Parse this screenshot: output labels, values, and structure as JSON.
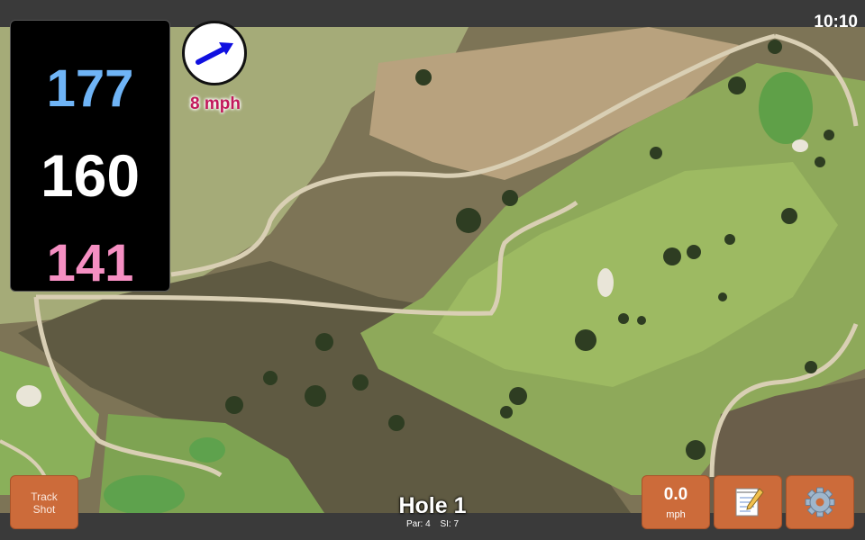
{
  "status_bar": {
    "time": "10:10"
  },
  "distances": {
    "back": "177",
    "middle": "160",
    "front": "141"
  },
  "wind": {
    "speed_label": "8 mph",
    "icon": "wind-direction-arrow-icon",
    "arrow_color": "#1010e0"
  },
  "buttons": {
    "track_shot_line1": "Track",
    "track_shot_line2": "Shot",
    "speed_value": "0.0",
    "speed_unit": "mph",
    "notes_icon": "notepad-icon",
    "settings_icon": "gear-icon"
  },
  "hole": {
    "title": "Hole 1",
    "par": "Par: 4",
    "si": "SI: 7"
  },
  "colors": {
    "button": "#cc6b3a",
    "back_distance": "#6fb4f6",
    "middle_distance": "#ffffff",
    "front_distance": "#f58fc2",
    "wind_label": "#c2185b"
  }
}
